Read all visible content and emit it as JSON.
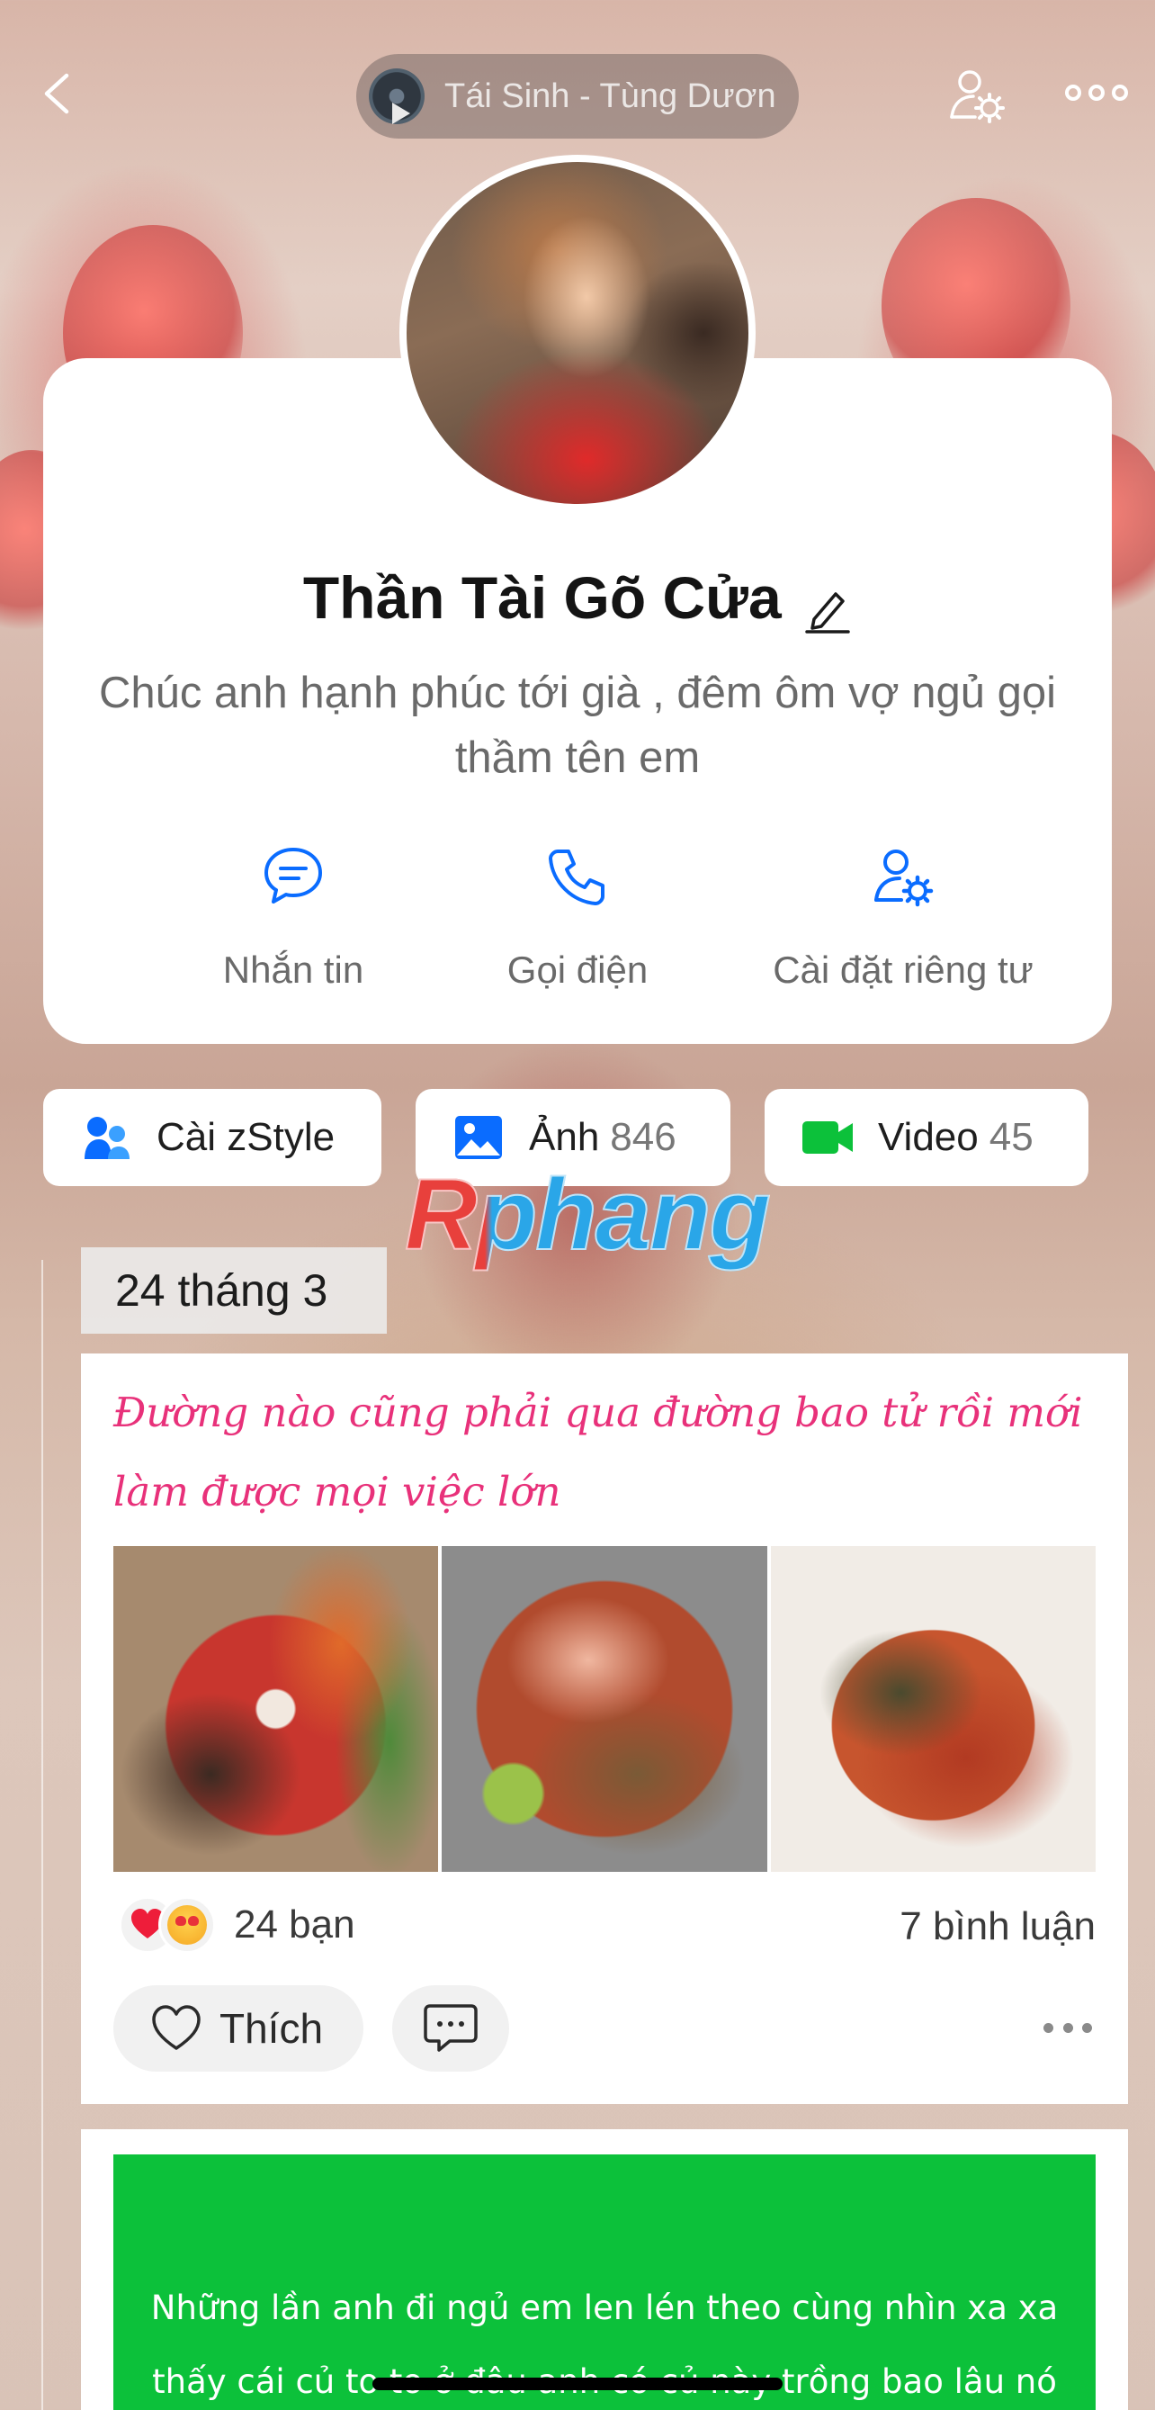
{
  "header": {
    "now_playing": "Tái Sinh - Tùng Dươn",
    "back_icon": "chevron-left-icon",
    "settings_icon": "user-gear-icon",
    "more_icon": "more-horizontal-icon"
  },
  "profile": {
    "name": "Thần Tài Gõ Cửa",
    "status": "Chúc anh hạnh phúc tới già , đêm ôm vợ ngủ gọi thầm tên em",
    "actions": [
      {
        "label": "Nhắn tin",
        "icon": "chat-bubble-icon"
      },
      {
        "label": "Gọi điện",
        "icon": "phone-icon"
      },
      {
        "label": "Cài đặt riêng tư",
        "icon": "user-gear-icon"
      }
    ]
  },
  "tabs": {
    "zstyle": {
      "label": "Cài zStyle"
    },
    "photos": {
      "label": "Ảnh",
      "count": "846"
    },
    "videos": {
      "label": "Video",
      "count": "45"
    }
  },
  "watermark": "Rphang",
  "timeline": {
    "date": "24 tháng 3",
    "post": {
      "text": "Đường nào cũng phải qua đường bao tử rồi mới làm được mọi việc lớn",
      "reaction_count": "24 bạn",
      "comment_count": "7 bình luận",
      "like_label": "Thích"
    },
    "next_post_text": "Những lần anh đi ngủ em len lén theo cùng nhìn xa xa thấy cái củ to to ở đâu anh có củ này trồng bao lâu nó"
  },
  "colors": {
    "accent_blue": "#0a6cff",
    "post_text_pink": "#e8317a",
    "video_green": "#0cc13a",
    "banner_green": "#0cc13a"
  }
}
